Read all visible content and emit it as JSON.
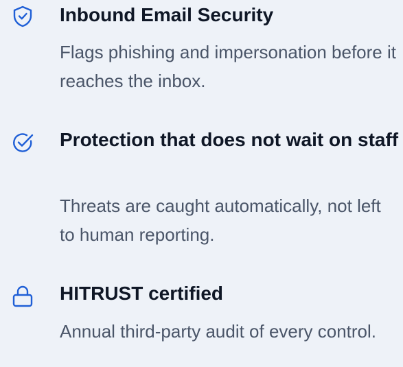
{
  "colors": {
    "background": "#eef2f8",
    "title": "#0f1726",
    "description": "#4a5568",
    "icon_accent": "#1f5fd6"
  },
  "features": [
    {
      "icon": "shield-check-icon",
      "title": "Inbound Email Security",
      "description": "Flags phishing and impersonation before it reaches the inbox."
    },
    {
      "icon": "check-circle-icon",
      "title": "Protection that does not wait on staff",
      "description": "Threats are caught automatically, not left to human reporting."
    },
    {
      "icon": "lock-icon",
      "title": "HITRUST certified",
      "description": "Annual third-party audit of every control."
    }
  ]
}
